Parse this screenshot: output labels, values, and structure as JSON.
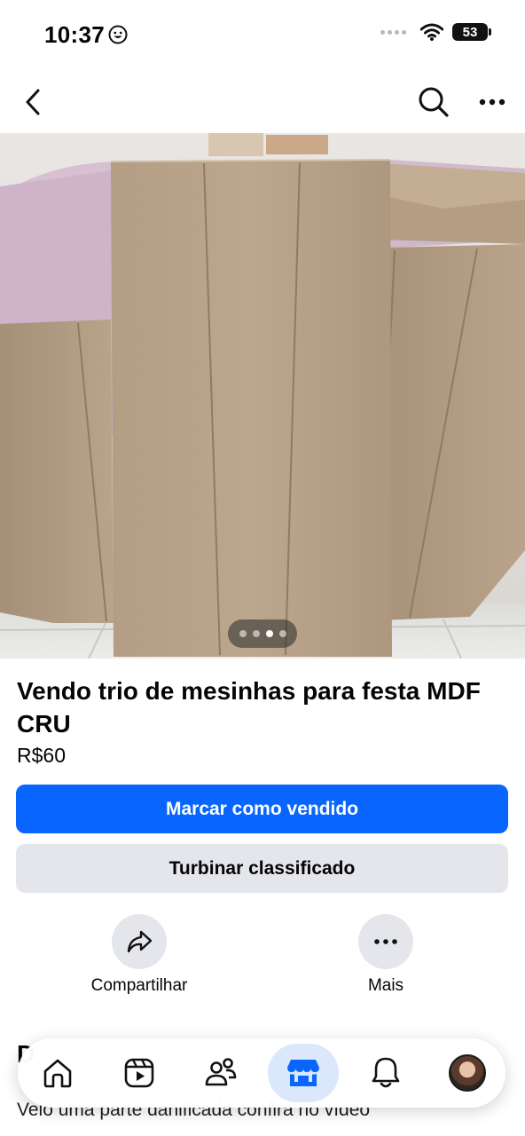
{
  "status_bar": {
    "time": "10:37",
    "battery": "53"
  },
  "listing": {
    "title": "Vendo trio de mesinhas para festa MDF CRU",
    "price": "R$60",
    "photo_pager": {
      "total": 4,
      "active_index": 2
    }
  },
  "buttons": {
    "mark_sold": "Marcar como vendido",
    "boost": "Turbinar classificado"
  },
  "actions": {
    "share": "Compartilhar",
    "more": "Mais"
  },
  "description": {
    "heading_partial": "D",
    "text": "Veio uma parte danificada confira no vídeo"
  },
  "tab_bar": {
    "active_tab": "marketplace",
    "accent_color": "#0866ff"
  },
  "colors": {
    "primary_button": "#0866ff",
    "secondary_button": "#e4e6eb"
  }
}
